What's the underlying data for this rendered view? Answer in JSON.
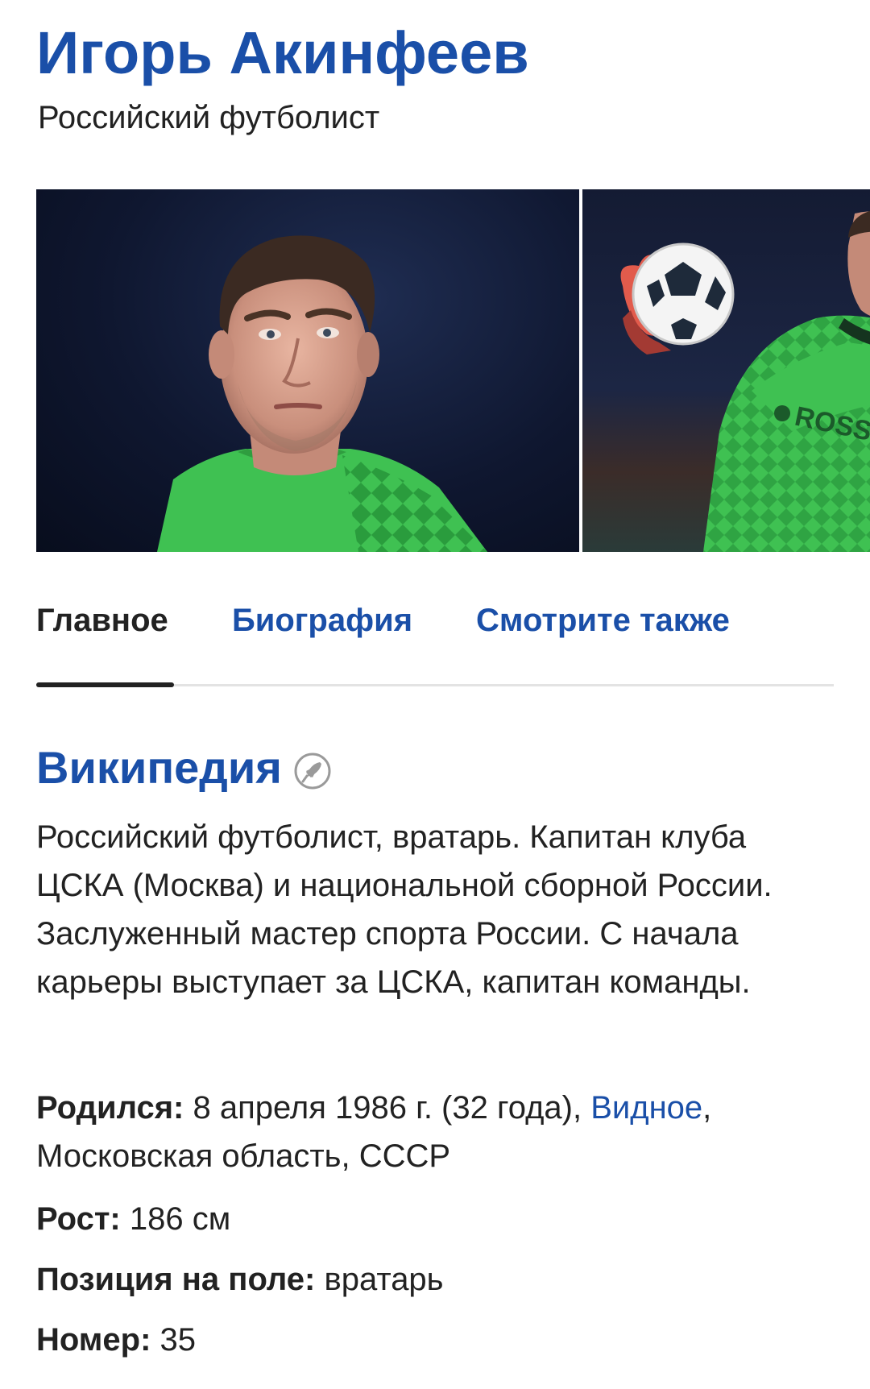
{
  "header": {
    "title": "Игорь Акинфеев",
    "subtitle": "Российский футболист"
  },
  "gallery": {
    "images": [
      {
        "subject": "portrait of goalkeeper in green jersey"
      },
      {
        "subject": "goalkeeper catching a ball, green jersey",
        "jersey_text": "ROSS"
      }
    ]
  },
  "tabs": [
    {
      "label": "Главное",
      "active": true
    },
    {
      "label": "Биография",
      "active": false
    },
    {
      "label": "Смотрите также",
      "active": false
    }
  ],
  "wiki": {
    "title": "Википедия",
    "icon": "rocket-icon",
    "summary": "Российский футболист, вратарь. Капитан клуба ЦСКА (Москва) и национальной сборной России. Заслуженный мастер спорта России. С начала карьеры выступает за ЦСКА, капитан команды.",
    "facts": {
      "born": {
        "label": "Родился:",
        "value": "8 апреля 1986 г. (32 года),",
        "place_link": "Видное",
        "place_rest": ", Московская область, СССР"
      },
      "height": {
        "label": "Рост:",
        "value": "186 см"
      },
      "position": {
        "label": "Позиция на поле:",
        "value": "вратарь"
      },
      "number": {
        "label": "Номер:",
        "value": "35"
      }
    }
  },
  "colors": {
    "link": "#1a4fa8",
    "text": "#222222",
    "jersey": "#3fc152"
  }
}
